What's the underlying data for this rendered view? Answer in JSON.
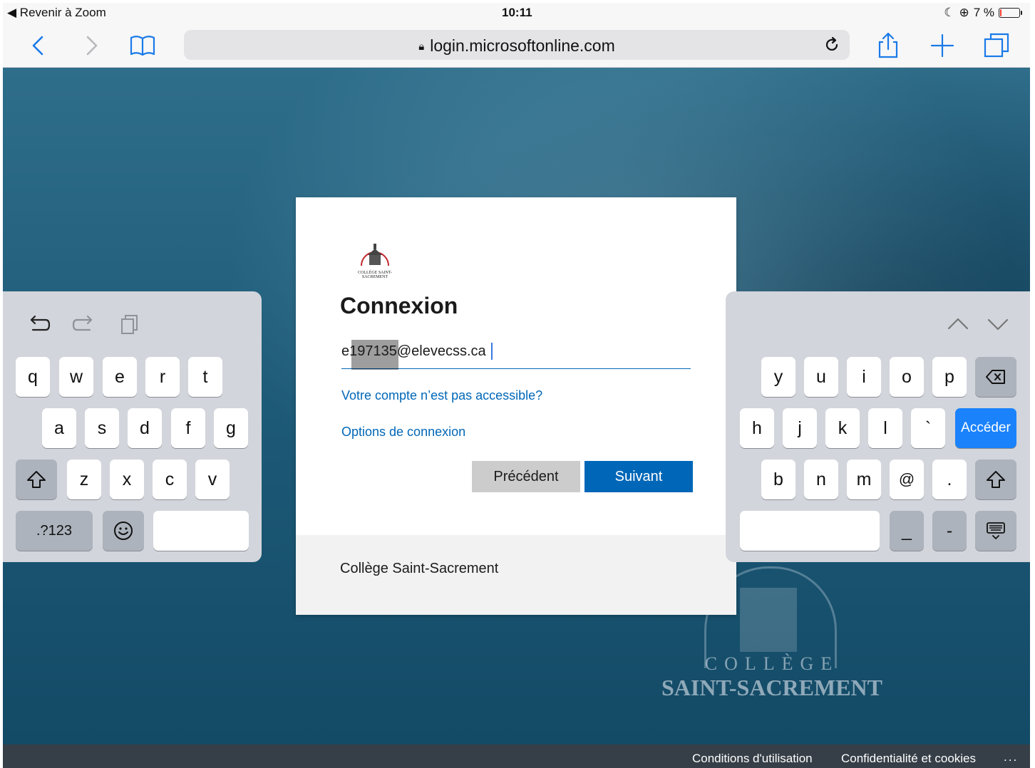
{
  "status": {
    "back_label": "◀ Revenir à Zoom",
    "time": "10:11",
    "battery": "7 %",
    "battery_level": 0.07
  },
  "browser": {
    "url": "login.microsoftonline.com"
  },
  "login": {
    "title": "Connexion",
    "email_value": "e197135@elevecss.ca",
    "link_account": "Votre compte n’est pas accessible?",
    "link_options": "Options de connexion",
    "prev_label": "Précédent",
    "next_label": "Suivant",
    "footer": "Collège Saint-Sacrement",
    "logo_text": "COLLÈGE SAINT-SACREMENT"
  },
  "background_seal": {
    "line1": "COLLÈGE",
    "line2": "SAINT-SACREMENT"
  },
  "keyboard": {
    "left": {
      "row1": [
        "q",
        "w",
        "e",
        "r",
        "t"
      ],
      "row2": [
        "a",
        "s",
        "d",
        "f",
        "g"
      ],
      "row3": [
        "z",
        "x",
        "c",
        "v"
      ],
      "numbers_key": ".?123"
    },
    "right": {
      "row1": [
        "y",
        "u",
        "i",
        "o",
        "p"
      ],
      "row2": [
        "h",
        "j",
        "k",
        "l",
        "`"
      ],
      "go_key": "Accéder",
      "row3": [
        "b",
        "n",
        "m",
        "@",
        "."
      ],
      "row4": [
        "_",
        "-"
      ]
    }
  },
  "footer": {
    "terms": "Conditions d'utilisation",
    "privacy": "Confidentialité et cookies",
    "more": "..."
  },
  "colors": {
    "accent": "#0067b8",
    "safari_blue": "#1a7ae8",
    "keyboard_blue": "#1a82fb"
  }
}
